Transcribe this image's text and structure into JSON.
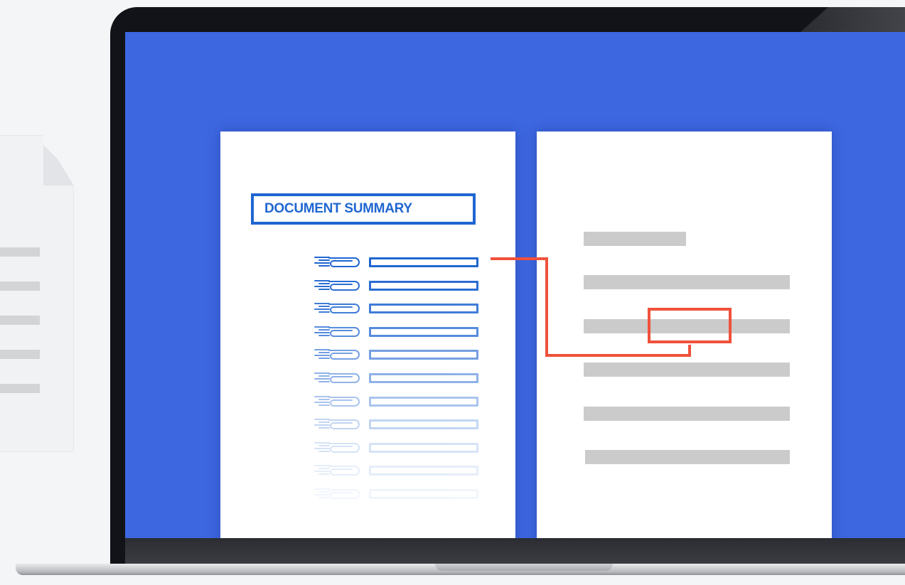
{
  "summary": {
    "title": "DOCUMENT SUMMARY",
    "entries": [
      {
        "opacity": 1.0
      },
      {
        "opacity": 0.95
      },
      {
        "opacity": 0.85
      },
      {
        "opacity": 0.75
      },
      {
        "opacity": 0.62
      },
      {
        "opacity": 0.5
      },
      {
        "opacity": 0.38
      },
      {
        "opacity": 0.27
      },
      {
        "opacity": 0.18
      },
      {
        "opacity": 0.11
      },
      {
        "opacity": 0.06
      }
    ]
  },
  "colors": {
    "screen": "#3d67e0",
    "accent_blue": "#1f66d1",
    "highlight_red": "#f0513b",
    "text_placeholder": "#cbcbcb"
  },
  "icons": {
    "entry_icon": "paperclip-icon"
  }
}
